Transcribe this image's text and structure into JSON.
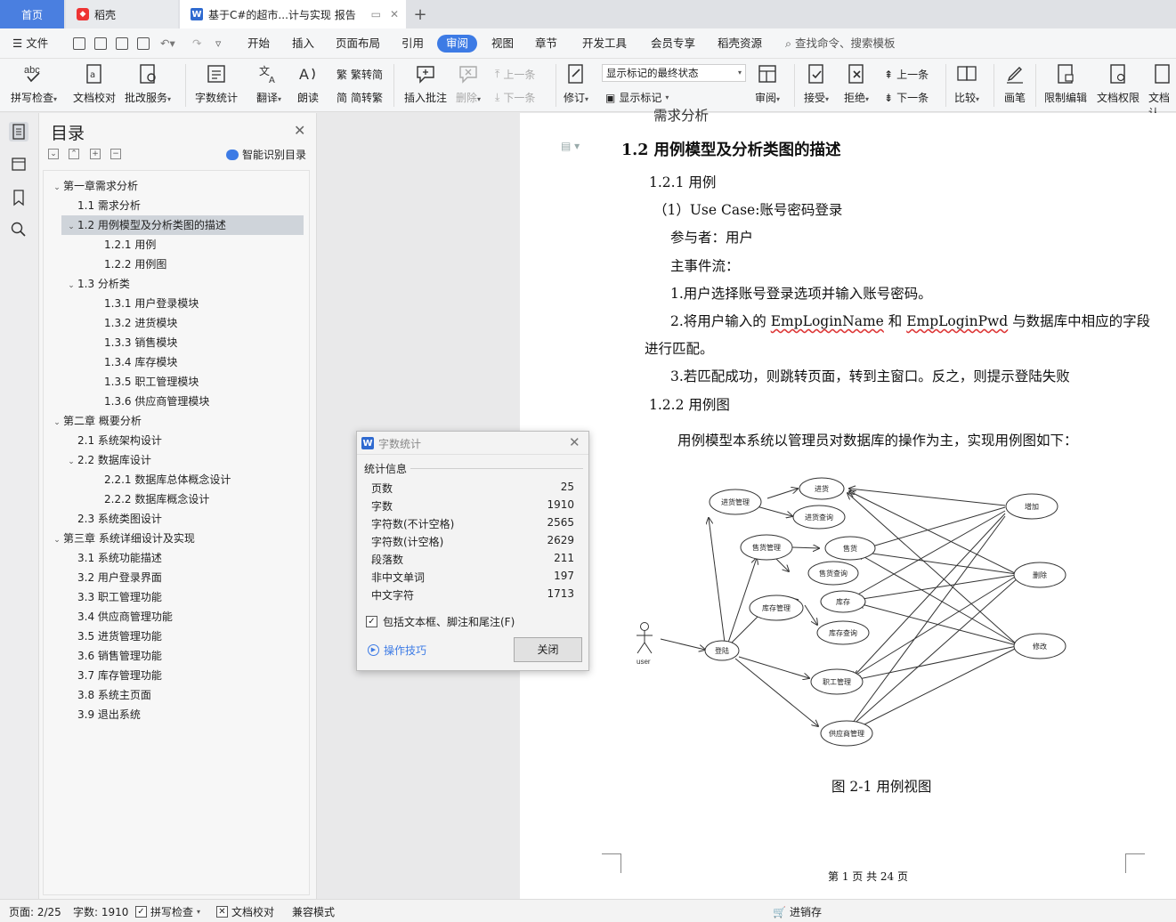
{
  "tabs": {
    "home": "首页",
    "daoke": "稻壳",
    "doc": "基于C#的超市...计与实现 报告",
    "new_tab": "+"
  },
  "menu": {
    "file": "文件",
    "items": [
      "开始",
      "插入",
      "页面布局",
      "引用",
      "审阅",
      "视图",
      "章节",
      "开发工具",
      "会员专享",
      "稻壳资源"
    ],
    "search": "查找命令、搜索模板"
  },
  "ribbon": {
    "spell_check": "拼写检查",
    "doc_proof": "文档校对",
    "review_service": "批改服务",
    "word_count": "字数统计",
    "translate": "翻译",
    "read_aloud": "朗读",
    "trad": "繁转简",
    "simp": "简转繁",
    "insert_comment": "插入批注",
    "delete": "删除",
    "prev": "上一条",
    "next": "下一条",
    "track": "修订",
    "markup_state": "显示标记的最终状态",
    "show_markup": "显示标记",
    "review": "审阅",
    "accept": "接受",
    "reject": "拒绝",
    "prev2": "上一条",
    "next2": "下一条",
    "compare": "比较",
    "pen": "画笔",
    "restrict": "限制编辑",
    "permission": "文档权限",
    "doc_more": "文档认"
  },
  "toc": {
    "title": "目录",
    "smart": "智能识别目录",
    "items": [
      {
        "text": "第一章需求分析",
        "level": 0,
        "arrow": "open"
      },
      {
        "text": "1.1 需求分析",
        "level": 1,
        "arrow": ""
      },
      {
        "text": "1.2  用例模型及分析类图的描述",
        "level": 1,
        "arrow": "open",
        "selected": true
      },
      {
        "text": "1.2.1  用例",
        "level": 2,
        "arrow": ""
      },
      {
        "text": "1.2.2  用例图",
        "level": 2,
        "arrow": ""
      },
      {
        "text": "1.3 分析类",
        "level": 1,
        "arrow": "open"
      },
      {
        "text": "1.3.1 用户登录模块",
        "level": 2,
        "arrow": ""
      },
      {
        "text": "1.3.2 进货模块",
        "level": 2,
        "arrow": ""
      },
      {
        "text": "1.3.3 销售模块",
        "level": 2,
        "arrow": ""
      },
      {
        "text": "1.3.4 库存模块",
        "level": 2,
        "arrow": ""
      },
      {
        "text": "1.3.5 职工管理模块",
        "level": 2,
        "arrow": ""
      },
      {
        "text": "1.3.6 供应商管理模块",
        "level": 2,
        "arrow": ""
      },
      {
        "text": "第二章  概要分析",
        "level": 0,
        "arrow": "open"
      },
      {
        "text": "2.1 系统架构设计",
        "level": 1,
        "arrow": ""
      },
      {
        "text": "2.2 数据库设计",
        "level": 1,
        "arrow": "open"
      },
      {
        "text": "2.2.1 数据库总体概念设计",
        "level": 2,
        "arrow": ""
      },
      {
        "text": "2.2.2 数据库概念设计",
        "level": 2,
        "arrow": ""
      },
      {
        "text": "2.3 系统类图设计",
        "level": 1,
        "arrow": ""
      },
      {
        "text": "第三章  系统详细设计及实现",
        "level": 0,
        "arrow": "open"
      },
      {
        "text": "3.1 系统功能描述",
        "level": 1,
        "arrow": ""
      },
      {
        "text": "3.2 用户登录界面",
        "level": 1,
        "arrow": ""
      },
      {
        "text": "3.3 职工管理功能",
        "level": 1,
        "arrow": ""
      },
      {
        "text": "3.4 供应商管理功能",
        "level": 1,
        "arrow": ""
      },
      {
        "text": "3.5 进货管理功能",
        "level": 1,
        "arrow": ""
      },
      {
        "text": "3.6 销售管理功能",
        "level": 1,
        "arrow": ""
      },
      {
        "text": "3.7 库存管理功能",
        "level": 1,
        "arrow": ""
      },
      {
        "text": "3.8 系统主页面",
        "level": 1,
        "arrow": ""
      },
      {
        "text": "3.9 退出系统",
        "level": 1,
        "arrow": ""
      }
    ]
  },
  "doc": {
    "cut_heading": "需求分析",
    "heading": "1.2  用例模型及分析类图的描述",
    "sub1": "1.2.1  用例",
    "case_line": "（1）Use   Case:账号密码登录",
    "actor": "参与者：用户",
    "flow": "主事件流：",
    "step1": "1.用户选择账号登录选项并输入账号密码。",
    "step2_a": "2.将用户输入的 ",
    "step2_w1": "EmpLoginName",
    "step2_b": " 和 ",
    "step2_w2": "EmpLoginPwd",
    "step2_c": " 与数据库中相应的字段",
    "step2_d": "进行匹配。",
    "step3": "3.若匹配成功，则跳转页面，转到主窗口。反之，则提示登陆失败",
    "sub2": "1.2.2  用例图",
    "intro": "用例模型本系统以管理员对数据库的操作为主，实现用例图如下：",
    "caption": "图 2-1  用例视图",
    "footer": "第  1  页  共  24  页"
  },
  "diagram": {
    "actor": "user",
    "nodes": {
      "login": "登陆",
      "purchase_mgmt": "进货管理",
      "purchase": "进货",
      "purchase_query": "进货查询",
      "sales_mgmt": "售货管理",
      "sales": "售货",
      "sales_query": "售货查询",
      "stock_mgmt": "库存管理",
      "stock": "库存",
      "stock_query": "库存查询",
      "staff_mgmt": "职工管理",
      "supplier_mgmt": "供应商管理",
      "add": "增加",
      "delete": "删除",
      "modify": "修改"
    }
  },
  "dialog": {
    "title": "字数统计",
    "section": "统计信息",
    "stats": [
      {
        "label": "页数",
        "value": "25"
      },
      {
        "label": "字数",
        "value": "1910"
      },
      {
        "label": "字符数(不计空格)",
        "value": "2565"
      },
      {
        "label": "字符数(计空格)",
        "value": "2629"
      },
      {
        "label": "段落数",
        "value": "211"
      },
      {
        "label": "非中文单词",
        "value": "197"
      },
      {
        "label": "中文字符",
        "value": "1713"
      }
    ],
    "include": "包括文本框、脚注和尾注(F)",
    "tips": "操作技巧",
    "close": "关闭"
  },
  "status": {
    "page": "页面: 2/25",
    "words": "字数: 1910",
    "spell": "拼写检查",
    "proof": "文档校对",
    "compat": "兼容模式",
    "center": "进销存"
  },
  "colors": {
    "accent": "#3d7be5",
    "tab_home": "#4a7fe0"
  }
}
